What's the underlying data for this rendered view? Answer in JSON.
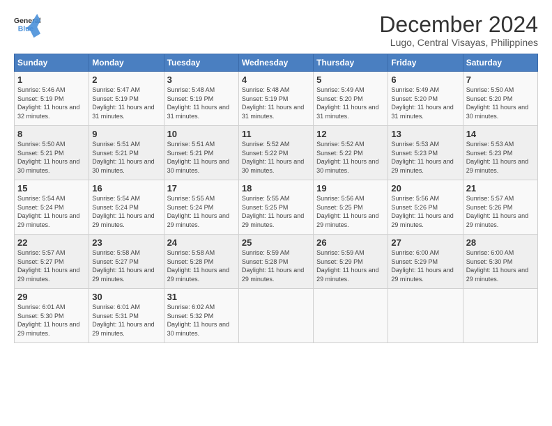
{
  "logo": {
    "line1": "General",
    "line2": "Blue"
  },
  "title": "December 2024",
  "location": "Lugo, Central Visayas, Philippines",
  "days_header": [
    "Sunday",
    "Monday",
    "Tuesday",
    "Wednesday",
    "Thursday",
    "Friday",
    "Saturday"
  ],
  "weeks": [
    [
      {
        "day": "1",
        "sunrise": "5:46 AM",
        "sunset": "5:19 PM",
        "daylight": "11 hours and 32 minutes."
      },
      {
        "day": "2",
        "sunrise": "5:47 AM",
        "sunset": "5:19 PM",
        "daylight": "11 hours and 31 minutes."
      },
      {
        "day": "3",
        "sunrise": "5:48 AM",
        "sunset": "5:19 PM",
        "daylight": "11 hours and 31 minutes."
      },
      {
        "day": "4",
        "sunrise": "5:48 AM",
        "sunset": "5:19 PM",
        "daylight": "11 hours and 31 minutes."
      },
      {
        "day": "5",
        "sunrise": "5:49 AM",
        "sunset": "5:20 PM",
        "daylight": "11 hours and 31 minutes."
      },
      {
        "day": "6",
        "sunrise": "5:49 AM",
        "sunset": "5:20 PM",
        "daylight": "11 hours and 31 minutes."
      },
      {
        "day": "7",
        "sunrise": "5:50 AM",
        "sunset": "5:20 PM",
        "daylight": "11 hours and 30 minutes."
      }
    ],
    [
      {
        "day": "8",
        "sunrise": "5:50 AM",
        "sunset": "5:21 PM",
        "daylight": "11 hours and 30 minutes."
      },
      {
        "day": "9",
        "sunrise": "5:51 AM",
        "sunset": "5:21 PM",
        "daylight": "11 hours and 30 minutes."
      },
      {
        "day": "10",
        "sunrise": "5:51 AM",
        "sunset": "5:21 PM",
        "daylight": "11 hours and 30 minutes."
      },
      {
        "day": "11",
        "sunrise": "5:52 AM",
        "sunset": "5:22 PM",
        "daylight": "11 hours and 30 minutes."
      },
      {
        "day": "12",
        "sunrise": "5:52 AM",
        "sunset": "5:22 PM",
        "daylight": "11 hours and 30 minutes."
      },
      {
        "day": "13",
        "sunrise": "5:53 AM",
        "sunset": "5:23 PM",
        "daylight": "11 hours and 29 minutes."
      },
      {
        "day": "14",
        "sunrise": "5:53 AM",
        "sunset": "5:23 PM",
        "daylight": "11 hours and 29 minutes."
      }
    ],
    [
      {
        "day": "15",
        "sunrise": "5:54 AM",
        "sunset": "5:24 PM",
        "daylight": "11 hours and 29 minutes."
      },
      {
        "day": "16",
        "sunrise": "5:54 AM",
        "sunset": "5:24 PM",
        "daylight": "11 hours and 29 minutes."
      },
      {
        "day": "17",
        "sunrise": "5:55 AM",
        "sunset": "5:24 PM",
        "daylight": "11 hours and 29 minutes."
      },
      {
        "day": "18",
        "sunrise": "5:55 AM",
        "sunset": "5:25 PM",
        "daylight": "11 hours and 29 minutes."
      },
      {
        "day": "19",
        "sunrise": "5:56 AM",
        "sunset": "5:25 PM",
        "daylight": "11 hours and 29 minutes."
      },
      {
        "day": "20",
        "sunrise": "5:56 AM",
        "sunset": "5:26 PM",
        "daylight": "11 hours and 29 minutes."
      },
      {
        "day": "21",
        "sunrise": "5:57 AM",
        "sunset": "5:26 PM",
        "daylight": "11 hours and 29 minutes."
      }
    ],
    [
      {
        "day": "22",
        "sunrise": "5:57 AM",
        "sunset": "5:27 PM",
        "daylight": "11 hours and 29 minutes."
      },
      {
        "day": "23",
        "sunrise": "5:58 AM",
        "sunset": "5:27 PM",
        "daylight": "11 hours and 29 minutes."
      },
      {
        "day": "24",
        "sunrise": "5:58 AM",
        "sunset": "5:28 PM",
        "daylight": "11 hours and 29 minutes."
      },
      {
        "day": "25",
        "sunrise": "5:59 AM",
        "sunset": "5:28 PM",
        "daylight": "11 hours and 29 minutes."
      },
      {
        "day": "26",
        "sunrise": "5:59 AM",
        "sunset": "5:29 PM",
        "daylight": "11 hours and 29 minutes."
      },
      {
        "day": "27",
        "sunrise": "6:00 AM",
        "sunset": "5:29 PM",
        "daylight": "11 hours and 29 minutes."
      },
      {
        "day": "28",
        "sunrise": "6:00 AM",
        "sunset": "5:30 PM",
        "daylight": "11 hours and 29 minutes."
      }
    ],
    [
      {
        "day": "29",
        "sunrise": "6:01 AM",
        "sunset": "5:30 PM",
        "daylight": "11 hours and 29 minutes."
      },
      {
        "day": "30",
        "sunrise": "6:01 AM",
        "sunset": "5:31 PM",
        "daylight": "11 hours and 29 minutes."
      },
      {
        "day": "31",
        "sunrise": "6:02 AM",
        "sunset": "5:32 PM",
        "daylight": "11 hours and 30 minutes."
      },
      null,
      null,
      null,
      null
    ]
  ]
}
